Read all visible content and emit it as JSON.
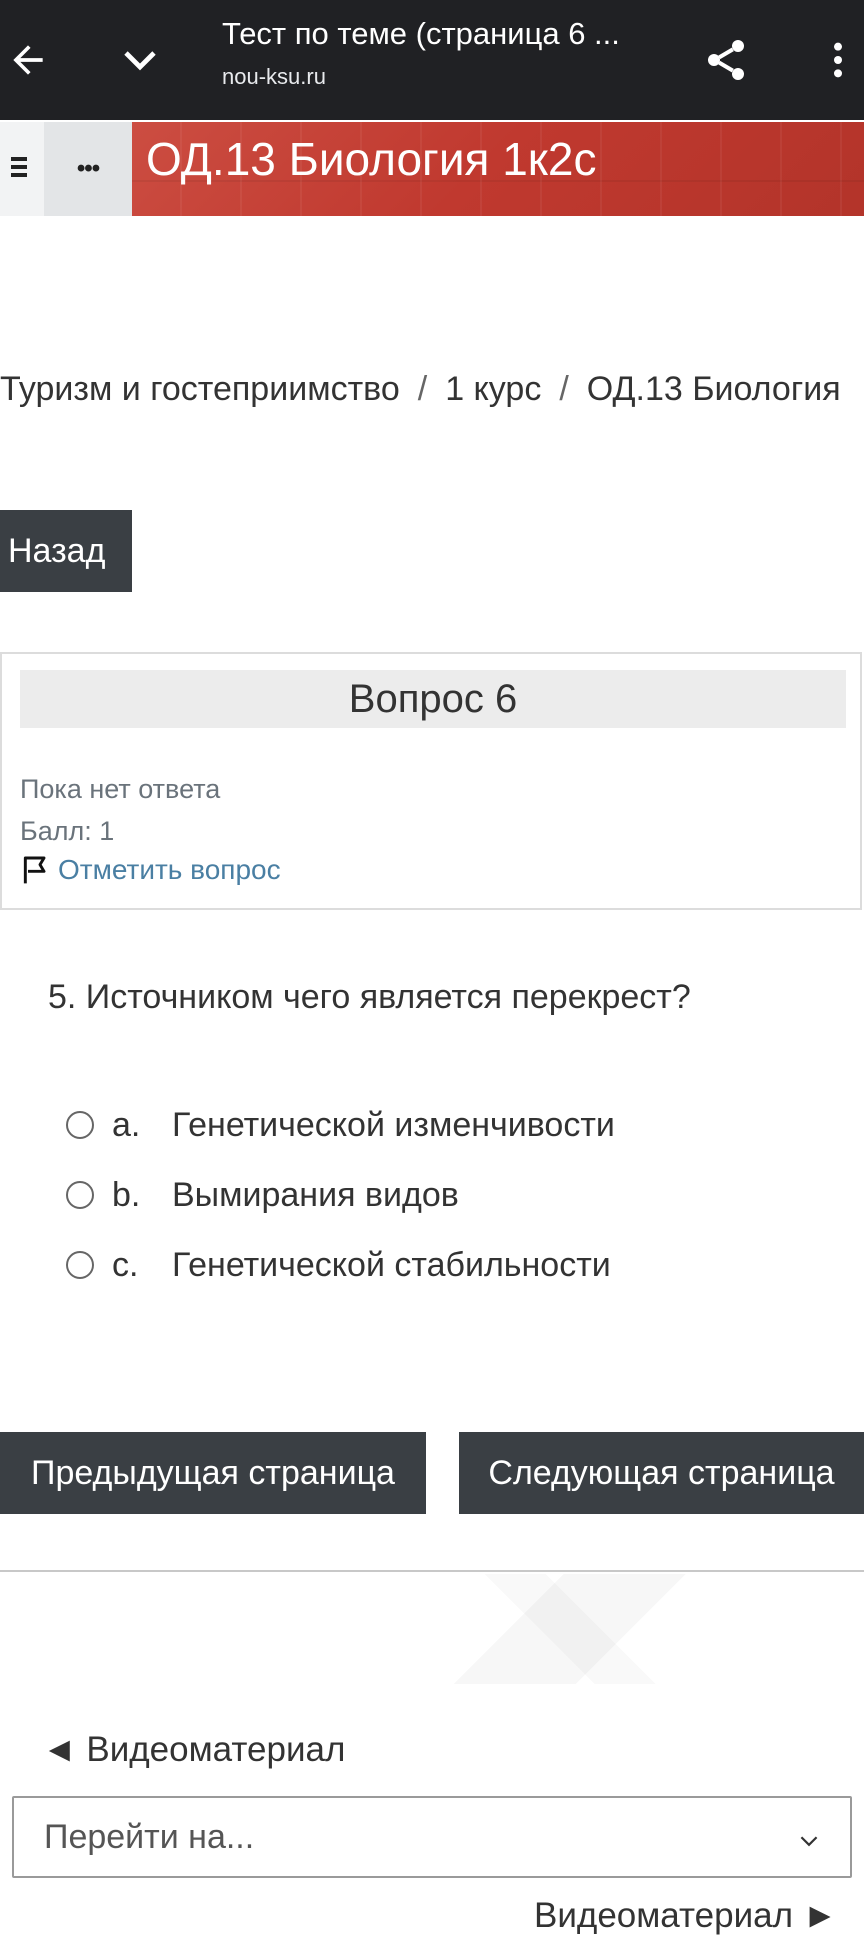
{
  "browser": {
    "title": "Тест по теме (страница 6 ...",
    "url": "nou-ksu.ru"
  },
  "course": {
    "title": "ОД.13 Биология 1к2с",
    "more_label": "•••"
  },
  "breadcrumb": [
    "Туризм и гостеприимство",
    "1 курс",
    "ОД.13 Биология"
  ],
  "breadcrumb_separator": "/",
  "back_button": "Назад",
  "question_info": {
    "heading": "Вопрос 6",
    "state": "Пока нет ответа",
    "grade": "Балл: 1",
    "flag_label": "Отметить вопрос"
  },
  "question": {
    "text": "5. Источником чего является перекрест?",
    "answers": [
      {
        "letter": "a.",
        "text": "Генетической изменчивости",
        "selected": false
      },
      {
        "letter": "b.",
        "text": "Вымирания видов",
        "selected": false
      },
      {
        "letter": "c.",
        "text": "Генетической стабильности",
        "selected": false
      }
    ]
  },
  "navigation": {
    "prev": "Предыдущая страница",
    "next": "Следующая страница"
  },
  "activity_nav": {
    "prev_link": "◄ Видеоматериал",
    "jump_placeholder": "Перейти на...",
    "next_link": "Видеоматериал ►"
  },
  "colors": {
    "topbar": "#202124",
    "header": "#c9473b",
    "button": "#3a3f44",
    "link": "#4a7fa3"
  },
  "icons": [
    "back-arrow-icon",
    "chevron-down-icon",
    "share-icon",
    "more-vert-icon",
    "hamburger-icon",
    "flag-icon"
  ]
}
